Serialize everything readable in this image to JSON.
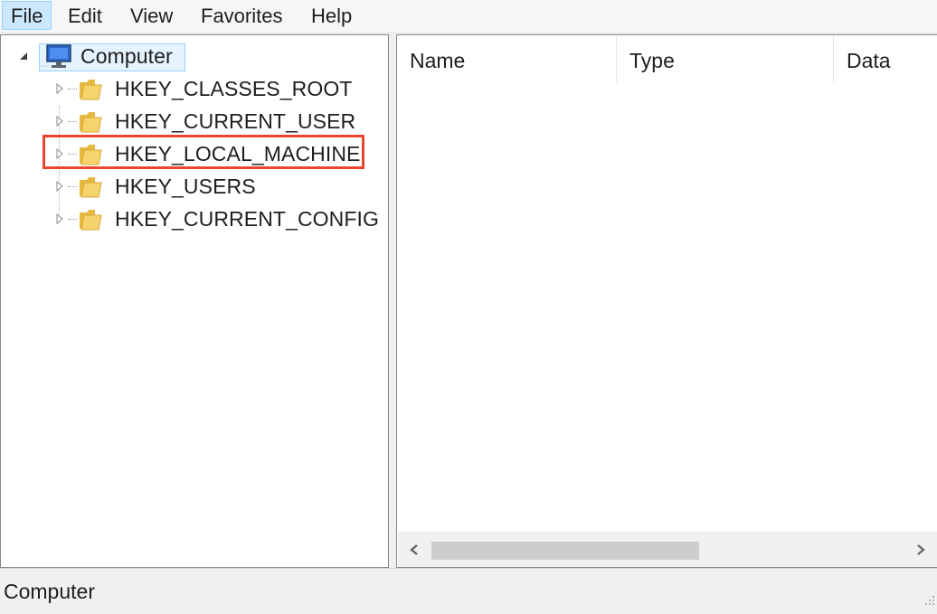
{
  "menu": {
    "items": [
      {
        "label": "File",
        "active": true
      },
      {
        "label": "Edit",
        "active": false
      },
      {
        "label": "View",
        "active": false
      },
      {
        "label": "Favorites",
        "active": false
      },
      {
        "label": "Help",
        "active": false
      }
    ]
  },
  "tree": {
    "root": {
      "label": "Computer",
      "icon": "computer-icon",
      "expanded": true,
      "selected": true
    },
    "keys": [
      {
        "label": "HKEY_CLASSES_ROOT",
        "icon": "folder-icon",
        "expanded": false
      },
      {
        "label": "HKEY_CURRENT_USER",
        "icon": "folder-icon",
        "expanded": false
      },
      {
        "label": "HKEY_LOCAL_MACHINE",
        "icon": "folder-icon",
        "expanded": false,
        "highlighted": true
      },
      {
        "label": "HKEY_USERS",
        "icon": "folder-icon",
        "expanded": false
      },
      {
        "label": "HKEY_CURRENT_CONFIG",
        "icon": "folder-icon",
        "expanded": false
      }
    ]
  },
  "list": {
    "columns": [
      "Name",
      "Type",
      "Data"
    ]
  },
  "status": {
    "text": "Computer"
  },
  "colors": {
    "highlight_box": "#e8462f",
    "selection_bg": "#e5f3ff",
    "folder": "#f2c94c"
  }
}
